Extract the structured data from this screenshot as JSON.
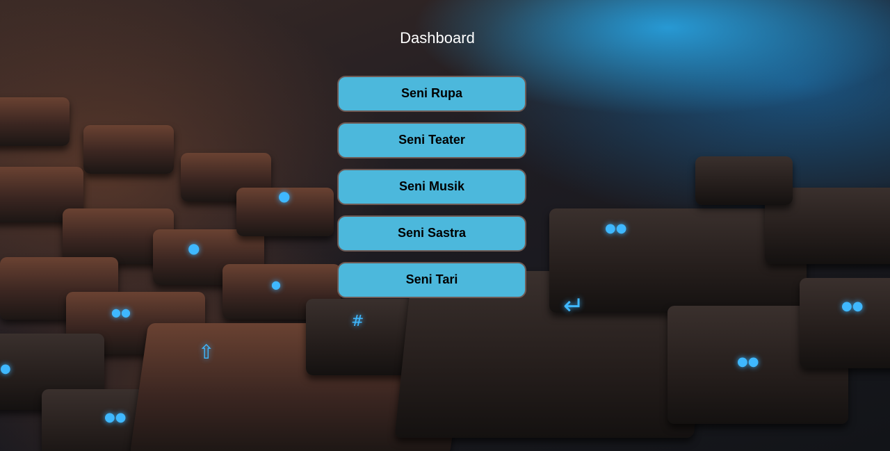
{
  "page": {
    "title": "Dashboard"
  },
  "menu": {
    "items": [
      {
        "label": "Seni Rupa"
      },
      {
        "label": "Seni Teater"
      },
      {
        "label": "Seni Musik"
      },
      {
        "label": "Seni Sastra"
      },
      {
        "label": "Seni Tari"
      }
    ]
  },
  "colors": {
    "button_background": "#4cb8dc",
    "button_border": "#6e5a55",
    "title_text": "#ffffff"
  },
  "background": {
    "icon": "keyboard-photo-background"
  }
}
